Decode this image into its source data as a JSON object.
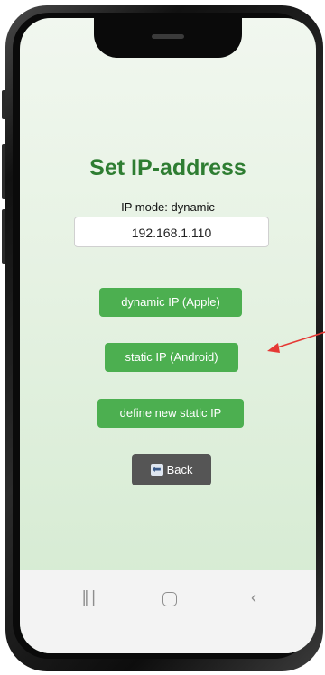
{
  "app": {
    "title": "Set IP-address",
    "mode_label": "IP mode: dynamic",
    "ip_value": "192.168.1.110"
  },
  "buttons": {
    "dynamic": "dynamic IP (Apple)",
    "static": "static IP (Android)",
    "define": "define new static IP",
    "back": "Back"
  },
  "navbar": {
    "recent": "recent-apps-icon",
    "home": "home-icon",
    "back": "back-icon"
  },
  "colors": {
    "title": "#2e7d32",
    "button": "#4caf50",
    "back_button": "#555555",
    "arrow": "#e53935"
  }
}
